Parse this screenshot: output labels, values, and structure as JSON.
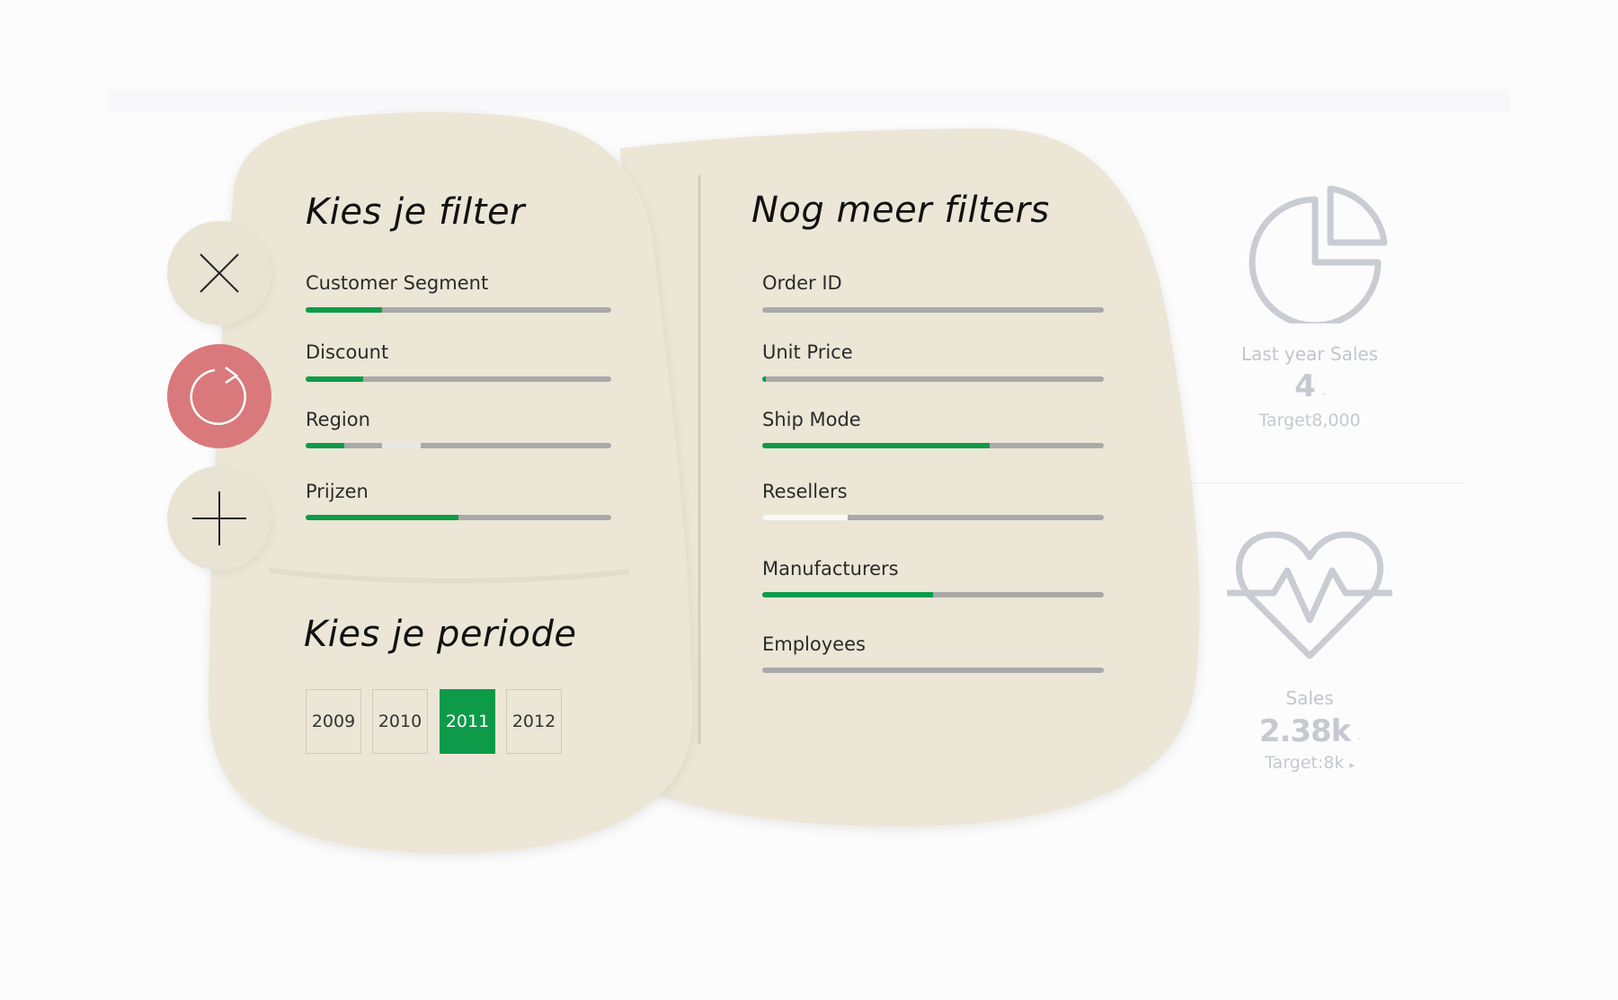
{
  "kpis": {
    "last_year": {
      "title": "Last year Sales",
      "value": "4",
      "target": "Target8,000",
      "icon": "pie-chart-icon"
    },
    "sales": {
      "title": "Sales",
      "value": "2.38k",
      "target": "Target:8k",
      "icon": "heartbeat-icon"
    }
  },
  "actions": {
    "close_icon": "close-icon",
    "refresh_icon": "refresh-icon",
    "add_icon": "plus-icon"
  },
  "left_panel": {
    "title": "Kies je filter",
    "filters": [
      {
        "label": "Customer Segment",
        "fill": 0.25
      },
      {
        "label": "Discount",
        "fill": 0.19
      },
      {
        "label": "Region",
        "fill": 0.125,
        "highlight": [
          0.25,
          0.375
        ]
      },
      {
        "label": "Prijzen",
        "fill": 0.5
      }
    ],
    "period_title": "Kies je periode",
    "years": [
      "2009",
      "2010",
      "2011",
      "2012"
    ],
    "selected_year": "2011"
  },
  "right_panel": {
    "title": "Nog meer filters",
    "filters": [
      {
        "label": "Order ID",
        "fill": 0
      },
      {
        "label": "Unit Price",
        "fill": 0.01
      },
      {
        "label": "Ship Mode",
        "fill": 0.665
      },
      {
        "label": "Resellers",
        "fill": 0.25,
        "fill_color": "white"
      },
      {
        "label": "Manufacturers",
        "fill": 0.5
      },
      {
        "label": "Employees",
        "fill": 0
      }
    ]
  },
  "colors": {
    "accent": "#0d9b49",
    "panel": "#ebe6d6",
    "refresh": "#d9797b",
    "kpi": "#c6c9d0"
  }
}
